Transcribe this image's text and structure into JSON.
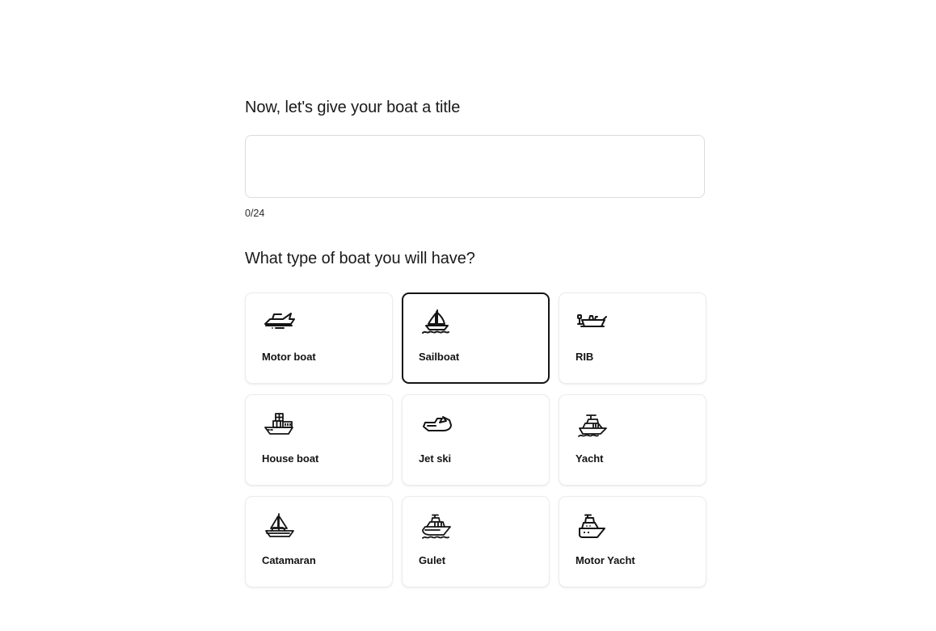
{
  "title_section": {
    "heading": "Now, let's give your boat a title",
    "input_value": "",
    "input_placeholder": "",
    "char_counter": "0/24",
    "max_length": 24
  },
  "type_section": {
    "heading": "What type of boat you will have?",
    "selected": "Sailboat",
    "options": [
      {
        "label": "Motor boat",
        "icon": "motor-boat-icon",
        "selected": false
      },
      {
        "label": "Sailboat",
        "icon": "sailboat-icon",
        "selected": true
      },
      {
        "label": "RIB",
        "icon": "rib-icon",
        "selected": false
      },
      {
        "label": "House boat",
        "icon": "house-boat-icon",
        "selected": false
      },
      {
        "label": "Jet ski",
        "icon": "jet-ski-icon",
        "selected": false
      },
      {
        "label": "Yacht",
        "icon": "yacht-icon",
        "selected": false
      },
      {
        "label": "Catamaran",
        "icon": "catamaran-icon",
        "selected": false
      },
      {
        "label": "Gulet",
        "icon": "gulet-icon",
        "selected": false
      },
      {
        "label": "Motor Yacht",
        "icon": "motor-yacht-icon",
        "selected": false
      }
    ]
  },
  "colors": {
    "background": "#ffffff",
    "text": "#1a1a1a",
    "card_border": "#ececec",
    "selected_border": "#141414",
    "input_border": "#dcdcdc"
  }
}
